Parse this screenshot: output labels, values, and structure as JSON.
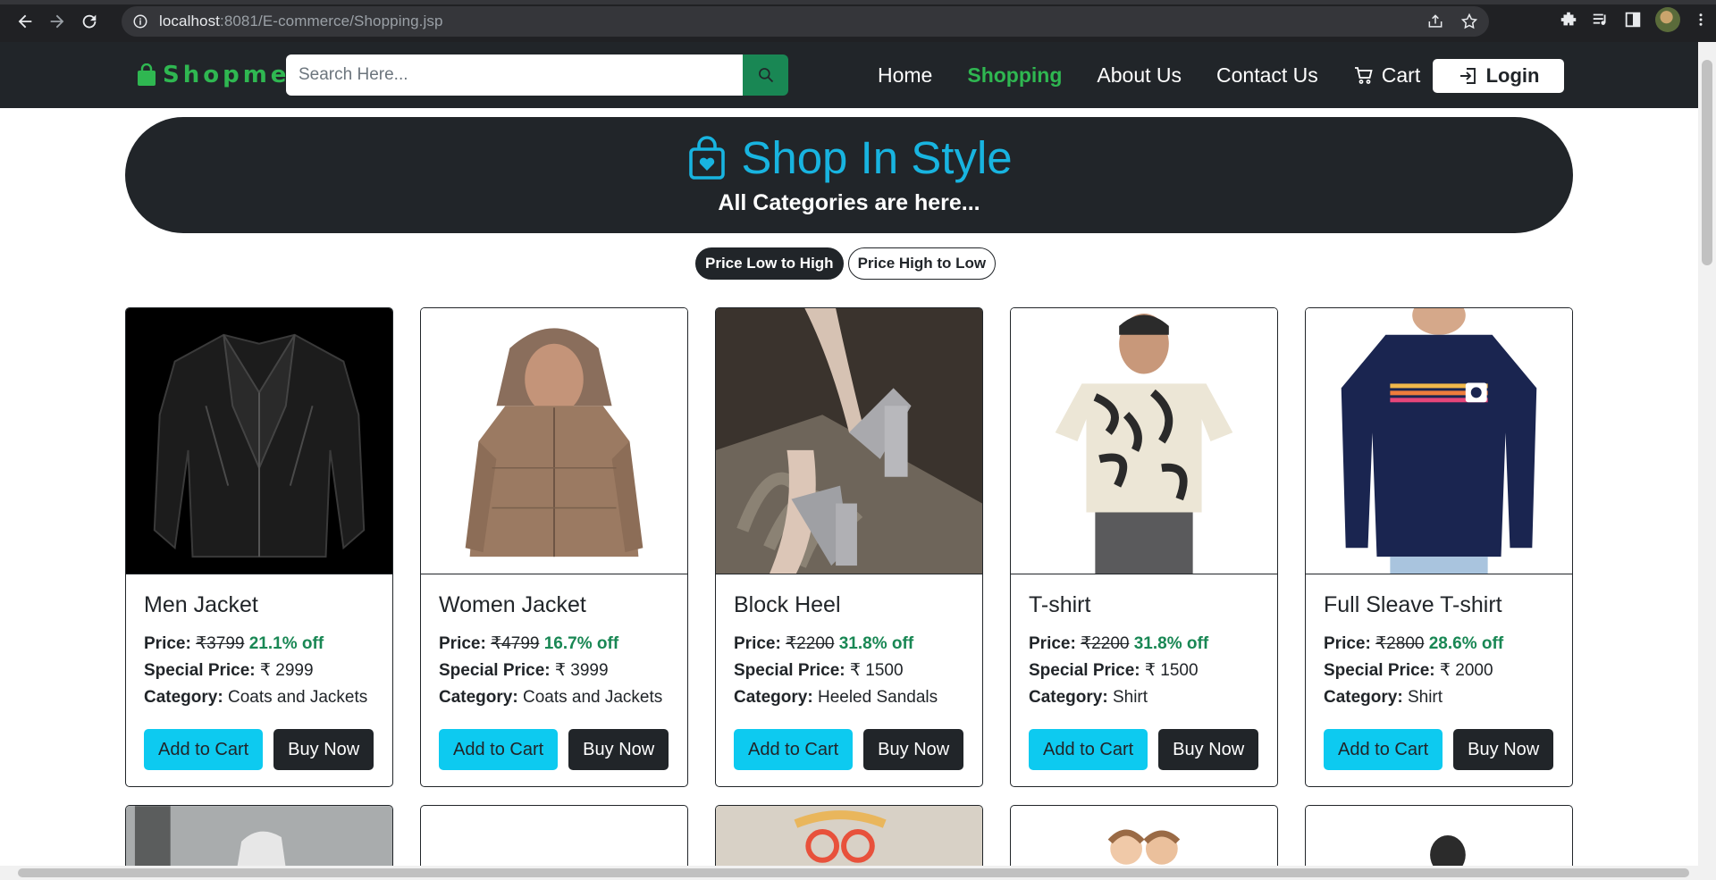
{
  "browser": {
    "url_host": "localhost",
    "url_rest": ":8081/E-commerce/Shopping.jsp"
  },
  "nav": {
    "brand": "Shopme",
    "search_placeholder": "Search Here...",
    "links": [
      "Home",
      "Shopping",
      "About Us",
      "Contact Us",
      "Cart"
    ],
    "active": "Shopping",
    "login_label": "Login"
  },
  "hero": {
    "title": "Shop In Style",
    "subtitle": "All Categories are here..."
  },
  "sort": {
    "low_high": "Price Low to High",
    "high_low": "Price High to Low"
  },
  "labels": {
    "price": "Price:",
    "special_price": "Special Price:",
    "category": "Category:",
    "add_to_cart": "Add to Cart",
    "buy_now": "Buy Now",
    "currency": "₹"
  },
  "products": [
    {
      "name": "Men Jacket",
      "price": "₹3799",
      "off": "21.1% off",
      "special": "₹ 2999",
      "category": "Coats and Jackets",
      "image": "black-leather-jacket"
    },
    {
      "name": "Women Jacket",
      "price": "₹4799",
      "off": "16.7% off",
      "special": "₹ 3999",
      "category": "Coats and Jackets",
      "image": "brown-hooded-jacket"
    },
    {
      "name": "Block Heel",
      "price": "₹2200",
      "off": "31.8% off",
      "special": "₹ 1500",
      "category": "Heeled Sandals",
      "image": "silver-block-heel"
    },
    {
      "name": "T-shirt",
      "price": "₹2200",
      "off": "31.8% off",
      "special": "₹ 1500",
      "category": "Shirt",
      "image": "zebra-print-tshirt"
    },
    {
      "name": "Full Sleave T-shirt",
      "price": "₹2800",
      "off": "28.6% off",
      "special": "₹ 2000",
      "category": "Shirt",
      "image": "navy-full-sleeve-tshirt"
    }
  ],
  "colors": {
    "dark": "#212529",
    "brand_green": "#2fb751",
    "hero_blue": "#18b4e0",
    "cart_cyan": "#0dcaf0",
    "discount_green": "#198754"
  }
}
